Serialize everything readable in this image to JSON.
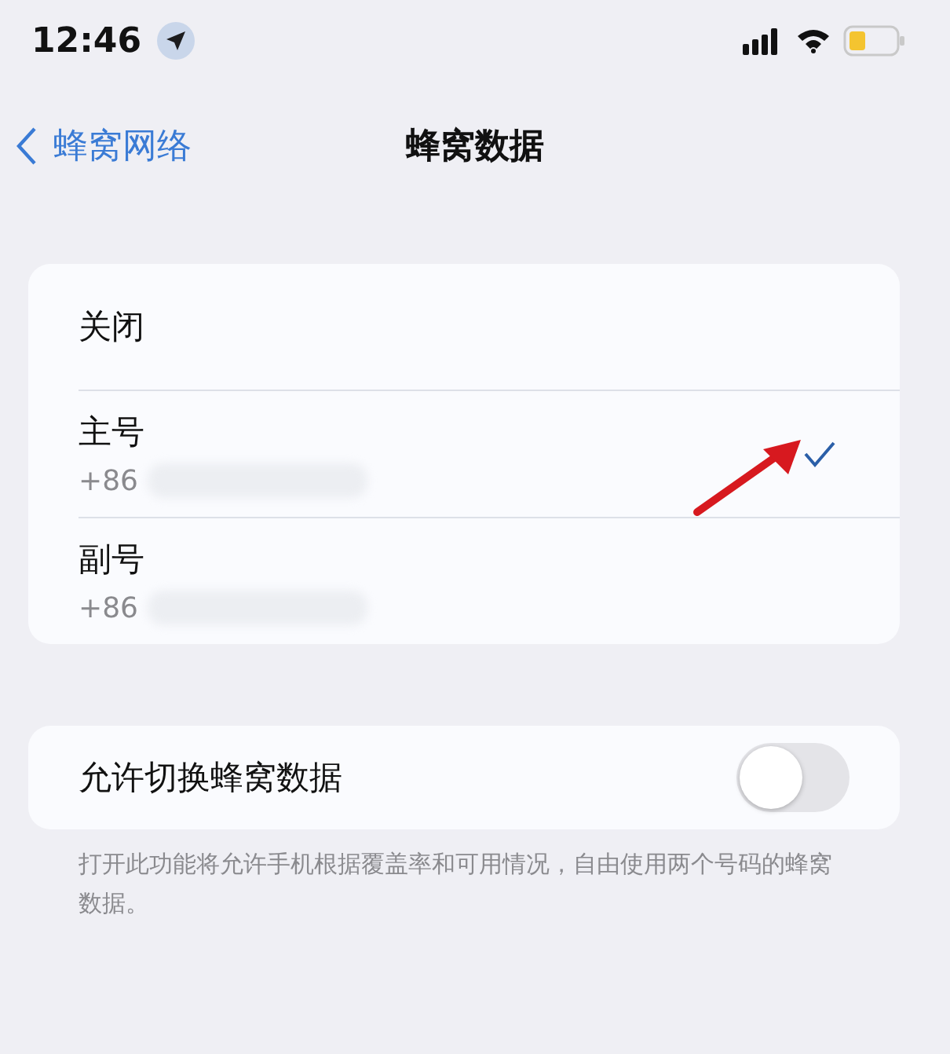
{
  "status_bar": {
    "time": "12:46"
  },
  "nav": {
    "back": "蜂窝网络",
    "title": "蜂窝数据"
  },
  "lines": [
    {
      "label": "关闭",
      "selected": false
    },
    {
      "label": "主号",
      "number": "+86",
      "selected": true
    },
    {
      "label": "副号",
      "number": "+86",
      "selected": false
    }
  ],
  "switch_row": {
    "label": "允许切换蜂窝数据",
    "on": false
  },
  "footer": "打开此功能将允许手机根据覆盖率和可用情况，自由使用两个号码的蜂窝数据。"
}
